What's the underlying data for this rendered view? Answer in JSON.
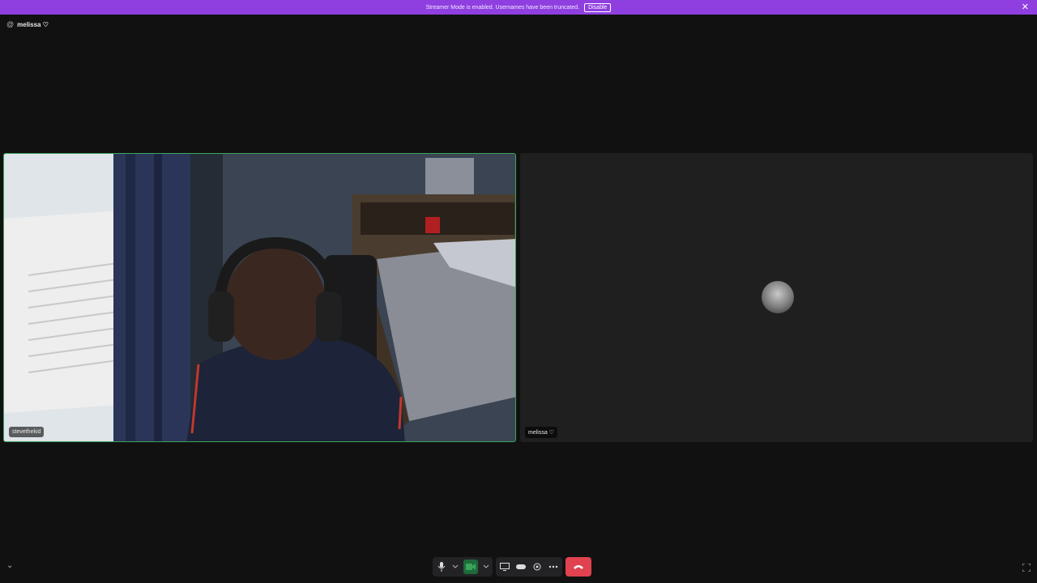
{
  "banner": {
    "message": "Streamer Mode is enabled. Usernames have been truncated.",
    "disable_label": "Disable",
    "close_icon": "close-icon",
    "color": "#8f3fe0"
  },
  "channel": {
    "icon": "at-icon",
    "name": "melissa ♡"
  },
  "participants": [
    {
      "name": "stevethekid",
      "video": true,
      "speaking": true,
      "border_color": "#3ba55c"
    },
    {
      "name": "melissa ♡",
      "video": false
    }
  ],
  "controls": {
    "mic_icon": "microphone-icon",
    "camera_icon": "camera-icon",
    "screen_icon": "screen-share-icon",
    "activity_icon": "gamepad-icon",
    "soundboard_icon": "soundboard-icon",
    "more_icon": "more-icon",
    "disconnect_icon": "phone-hangup-icon",
    "disconnect_color": "#e0424f"
  }
}
